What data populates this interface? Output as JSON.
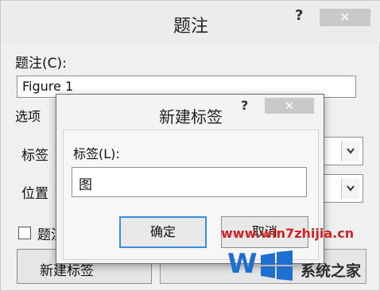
{
  "outer_dialog": {
    "title": "题注",
    "help": "?",
    "close": "✕",
    "caption_label": "题注(C):",
    "caption_value": "Figure 1",
    "options_legend": "选项",
    "label_row": "标签",
    "position_row": "位置",
    "exclude_text": "题注",
    "new_label_button": "新建标签"
  },
  "inner_dialog": {
    "title": "新建标签",
    "help": "?",
    "close": "✕",
    "label_text": "标签(L):",
    "label_value": "图",
    "ok": "确定",
    "cancel": "取消"
  },
  "watermark": {
    "url": "www.win7zhijia.cn",
    "site_name": "系统之家"
  }
}
